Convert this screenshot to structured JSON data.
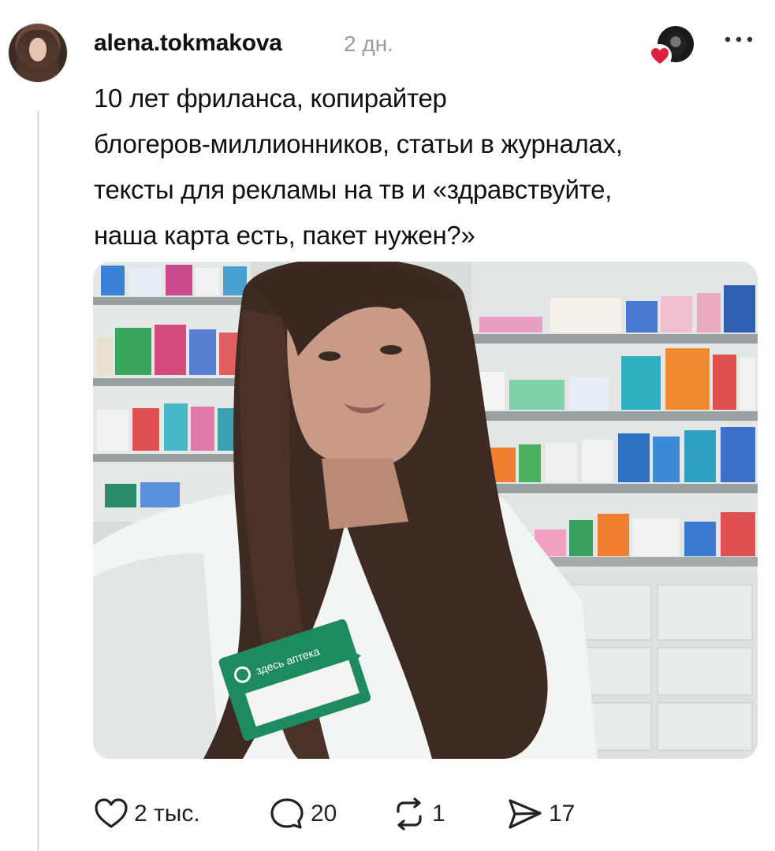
{
  "post": {
    "username": "alena.tokmakova",
    "time": "2 дн.",
    "text": "10 лет фриланса, копирайтер\nблогеров-миллионников, статьи в журналах,\nтексты для рекламы на тв и «здравствуйте,\nнаша карта есть, пакет нужен?»",
    "badge_text": "здесь аптека"
  },
  "actions": {
    "likes": "2 тыс.",
    "comments": "20",
    "reposts": "1",
    "shares": "17"
  },
  "colors": {
    "heart": "#e0203f",
    "thread_line": "#e3e3e3",
    "badge_green": "#1e8a5f"
  },
  "icons": {
    "like": "heart-outline-icon",
    "comment": "speech-bubble-icon",
    "repost": "repost-arrows-icon",
    "share": "paper-plane-icon",
    "more": "more-dots-icon",
    "liked": "heart-filled-icon"
  }
}
